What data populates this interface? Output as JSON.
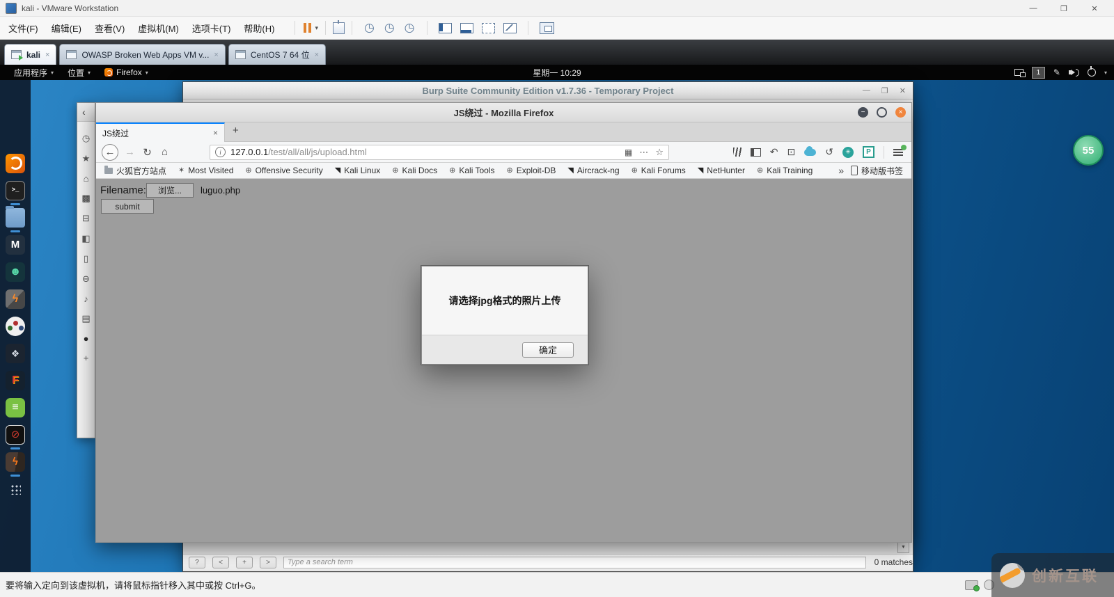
{
  "vmware": {
    "window_title": "kali - VMware Workstation",
    "menu_items": [
      "文件(F)",
      "编辑(E)",
      "查看(V)",
      "虚拟机(M)",
      "选项卡(T)",
      "帮助(H)"
    ],
    "tabs": [
      {
        "label": "kali",
        "active": true
      },
      {
        "label": "OWASP Broken Web Apps VM v...",
        "active": false
      },
      {
        "label": "CentOS 7 64 位",
        "active": false
      }
    ],
    "status_message": "要将输入定向到该虚拟机，请将鼠标指针移入其中或按 Ctrl+G。"
  },
  "kali": {
    "panel": {
      "applications": "应用程序",
      "places": "位置",
      "active_app": "Firefox",
      "clock": "星期一 10:29",
      "workspace_number": "1"
    },
    "dock_items": [
      "firefox",
      "terminal",
      "files",
      "metasploit",
      "armitage",
      "burpsuite",
      "beef",
      "gimp",
      "faraday",
      "text-editor",
      "screen-recorder",
      "cherrytree",
      "show-applications"
    ]
  },
  "burp": {
    "window_title": "Burp Suite Community Edition v1.7.36 - Temporary Project",
    "find_bar": {
      "help": "?",
      "prev": "<",
      "add": "+",
      "next": ">",
      "search_placeholder": "Type a search term",
      "matches_label": "0 matches"
    }
  },
  "firefox": {
    "window_title": "JS绕过 - Mozilla Firefox",
    "tab_title": "JS绕过",
    "url_host": "127.0.0.1",
    "url_path": "/test/all/all/js/upload.html",
    "bookmarks": [
      "火狐官方站点",
      "Most Visited",
      "Offensive Security",
      "Kali Linux",
      "Kali Docs",
      "Kali Tools",
      "Exploit-DB",
      "Aircrack-ng",
      "Kali Forums",
      "NetHunter",
      "Kali Training"
    ],
    "mobile_bookmarks_label": "移动版书签",
    "page": {
      "filename_label": "Filename:",
      "browse_button": "浏览...",
      "selected_file": "luguo.php",
      "submit_button": "submit"
    },
    "alert_dialog": {
      "message": "请选择jpg格式的照片上传",
      "ok_button": "确定"
    }
  },
  "overlay": {
    "notification_badge": "55",
    "watermark_text": "创新互联"
  },
  "fm_sidebar_icons": [
    "◷",
    "★",
    "⌂",
    "▩",
    "⊟",
    "◧",
    "▯",
    "⊖",
    "♪",
    "▤",
    "●",
    "+"
  ],
  "icons": {
    "window_minimize": "—",
    "window_maximize": "❐",
    "window_close": "✕",
    "circle_minimize": "−",
    "circle_maximize": "▣",
    "circle_close": "×",
    "chevron_down": "▾",
    "caret_down": "▼",
    "back_arrow": "←",
    "forward_arrow": "→",
    "reload": "↻",
    "home": "⌂",
    "info": "i",
    "qr_code": "▦",
    "ellipsis": "⋯",
    "bookmark_star": "☆",
    "undo": "↶",
    "screenshot": "⊡",
    "sync_refresh": "↺",
    "gear_asterisk": "✳",
    "proxy_letter": "P",
    "overflow_chevrons": "»",
    "new_tab_plus": "+",
    "close_tab": "×",
    "snapshot_clock": "◷",
    "globe": "⊕",
    "kali_brush": "◥",
    "star_six": "✶",
    "back_thin": "‹",
    "pen": "✎",
    "terminal_prompt": ">_",
    "metasploit_m": "M",
    "armitage_face": "☻",
    "lightning": "ϟ",
    "gimp_shape": "❖",
    "faraday_f": "F",
    "leafpad_lines": "≡",
    "record_blocked": "⊘"
  },
  "colors": {
    "accent_blue": "#0a84ff",
    "close_orange": "#f0853d",
    "desktop_blue": "#12619f",
    "dock_bg": "#0d1624",
    "pause_orange": "#e0822e"
  }
}
